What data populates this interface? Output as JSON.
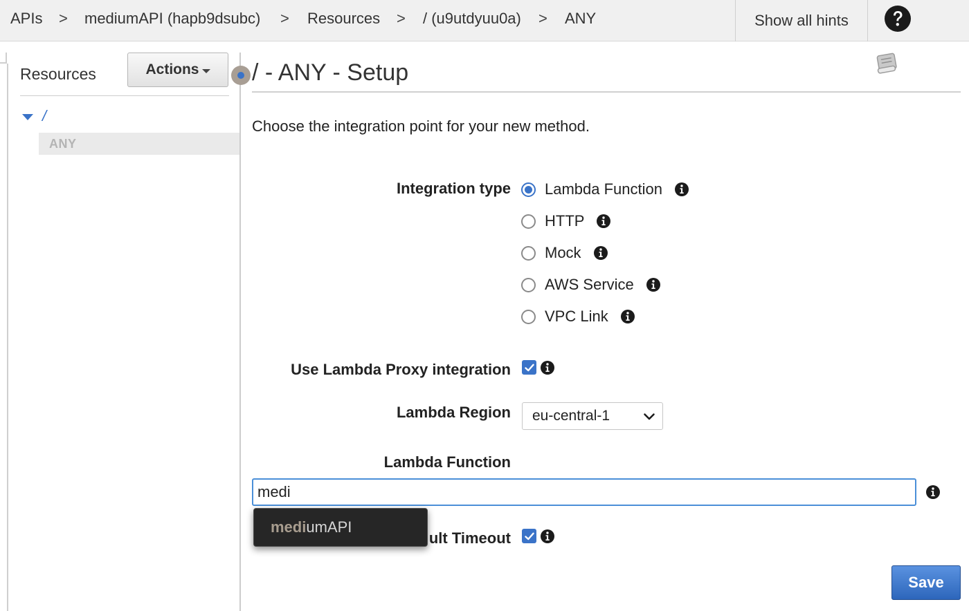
{
  "breadcrumb": {
    "items": [
      "APIs",
      "mediumAPI (hapb9dsubc)",
      "Resources",
      "/ (u9utdyuu0a)",
      "ANY"
    ],
    "separator": ">"
  },
  "header": {
    "hints_label": "Show all hints",
    "help_icon": "question-circle-icon"
  },
  "sidebar": {
    "title": "Resources",
    "actions_label": "Actions",
    "tree": {
      "root": "/",
      "child": "ANY"
    }
  },
  "main": {
    "title": "/ - ANY - Setup",
    "intro": "Choose the integration point for your new method.",
    "integration_type": {
      "label": "Integration type",
      "options": [
        "Lambda Function",
        "HTTP",
        "Mock",
        "AWS Service",
        "VPC Link"
      ],
      "selected": "Lambda Function"
    },
    "proxy": {
      "label": "Use Lambda Proxy integration",
      "checked": true
    },
    "region": {
      "label": "Lambda Region",
      "value": "eu-central-1"
    },
    "function": {
      "label": "Lambda Function",
      "value": "medi",
      "suggestion_match": "medi",
      "suggestion_rest": "umAPI"
    },
    "timeout": {
      "label_visible": "ult Timeout",
      "checked": true
    },
    "save_label": "Save"
  },
  "colors": {
    "accent": "#3a73c8",
    "save": "#2d66bb",
    "topbar": "#f0f0f0"
  }
}
